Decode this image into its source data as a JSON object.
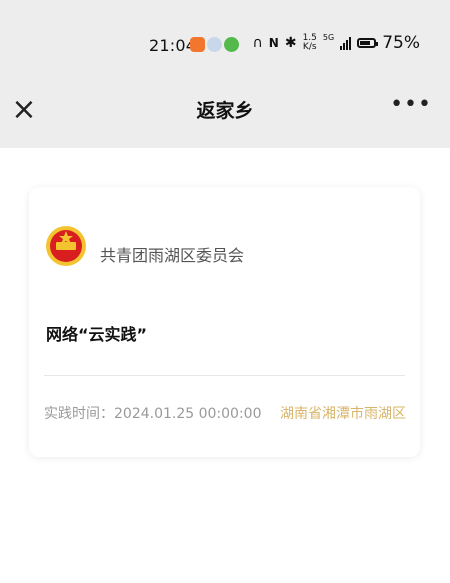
{
  "status_bar": {
    "time": "21:04",
    "net_speed_value": "1.5",
    "net_speed_unit": "K/s",
    "network_type": "5G",
    "battery_percent": "75%",
    "battery_level": 0.75
  },
  "nav": {
    "title": "返家乡",
    "close_label": "×",
    "more_label": "•••"
  },
  "card": {
    "org_name": "共青团雨湖区委员会",
    "activity_title": "网络“云实践”",
    "time_label": "实践时间：",
    "time_value": "2024.01.25 00:00:00",
    "location": "湖南省湘潭市雨湖区"
  },
  "colors": {
    "nav_background": "#ededed",
    "accent_gold": "#d8b56b",
    "logo_red": "#d81e1e",
    "logo_gold": "#f4c430"
  }
}
